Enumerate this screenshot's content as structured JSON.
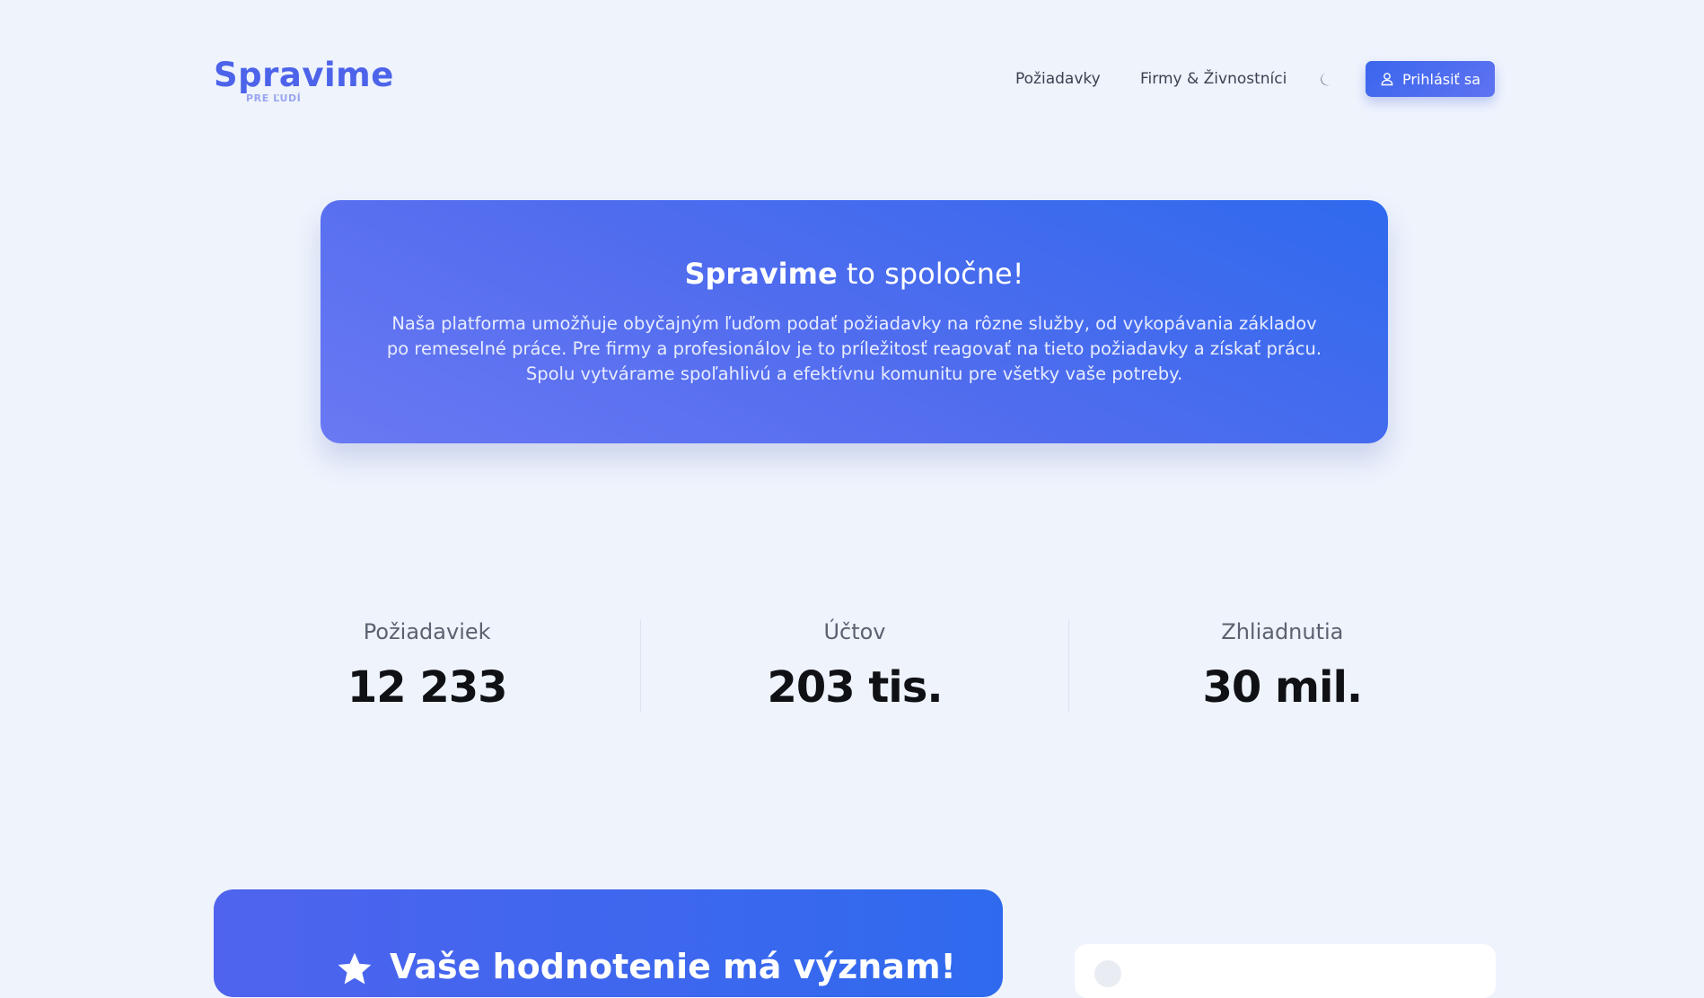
{
  "header": {
    "logo_main": "Spravime",
    "logo_sub": "PRE ĽUDÍ",
    "nav": {
      "requests": "Požiadavky",
      "firms": "Firmy & Živnostníci"
    },
    "login_label": "Prihlásiť sa",
    "theme_icon": "moon-icon"
  },
  "hero": {
    "title_bold": "Spravime",
    "title_rest": " to spoločne!",
    "text": "Naša platforma umožňuje obyčajným ľuďom podať požiadavky na rôzne služby, od vykopávania základov po remeselné práce. Pre firmy a profesionálov je to príležitosť reagovať na tieto požiadavky a získať prácu. Spolu vytvárame spoľahlivú a efektívnu komunitu pre všetky vaše potreby."
  },
  "stats": [
    {
      "label": "Požiadaviek",
      "value": "12 233"
    },
    {
      "label": "Účtov",
      "value": "203 tis."
    },
    {
      "label": "Zhliadnutia",
      "value": "30 mil."
    }
  ],
  "rating": {
    "title": "Vaše hodnotenie má význam!"
  },
  "colors": {
    "accent": "#3a66ee",
    "background": "#eef3fc",
    "hero_gradient_start": "#6a78f3",
    "hero_gradient_end": "#2f6aee"
  }
}
